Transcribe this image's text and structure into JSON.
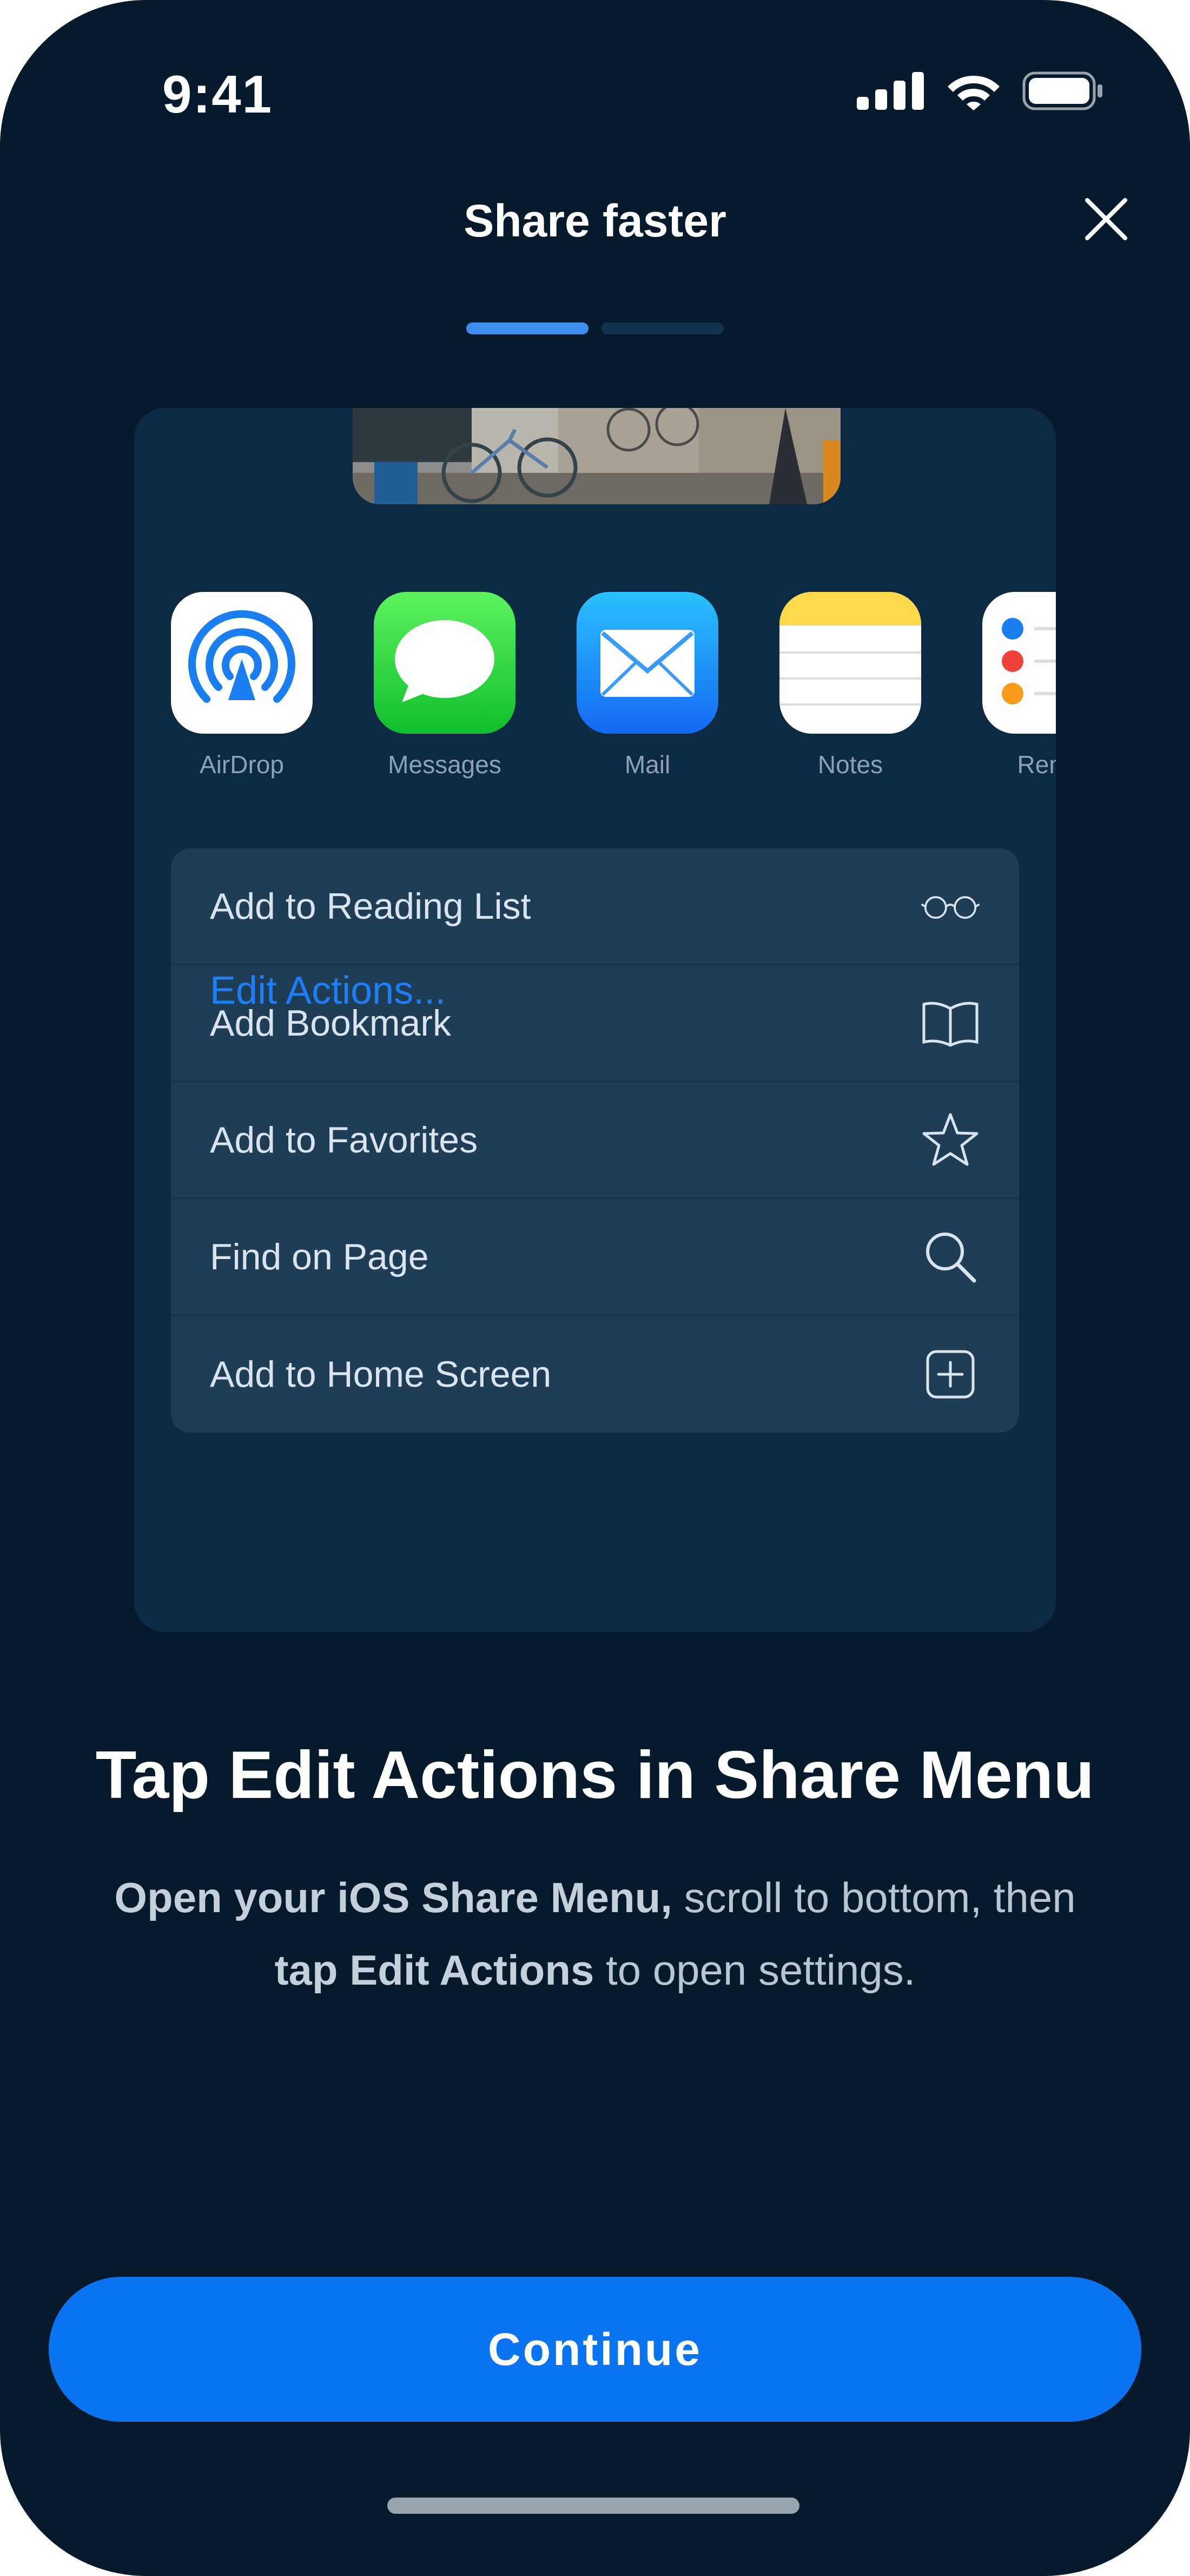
{
  "status_bar": {
    "time": "9:41"
  },
  "header": {
    "title": "Share faster",
    "progress": {
      "current": 1,
      "total": 2
    }
  },
  "colors": {
    "background": "#061a2b",
    "accent": "#0a74f0",
    "link": "#1e7ef5",
    "card": "#0c2b42"
  },
  "share_sheet": {
    "apps": [
      {
        "label": "AirDrop",
        "icon": "airdrop-icon"
      },
      {
        "label": "Messages",
        "icon": "messages-icon"
      },
      {
        "label": "Mail",
        "icon": "mail-icon"
      },
      {
        "label": "Notes",
        "icon": "notes-icon"
      },
      {
        "label": "Remin",
        "icon": "reminders-icon"
      }
    ],
    "actions": [
      {
        "label": "Add to Reading List",
        "icon": "glasses-icon"
      },
      {
        "label": "Add Bookmark",
        "icon": "book-icon"
      },
      {
        "label": "Add to Favorites",
        "icon": "star-icon"
      },
      {
        "label": "Find on Page",
        "icon": "search-icon"
      },
      {
        "label": "Add to Home Screen",
        "icon": "plus-square-icon"
      }
    ],
    "edit_actions_label": "Edit Actions..."
  },
  "instructions": {
    "headline": "Tap Edit Actions in Share Menu",
    "line1_bold": "Open your iOS Share Menu,",
    "line1_rest": " scroll to bottom, then",
    "line2_bold": "tap Edit Actions",
    "line2_rest": " to open settings."
  },
  "continue_label": "Continue"
}
